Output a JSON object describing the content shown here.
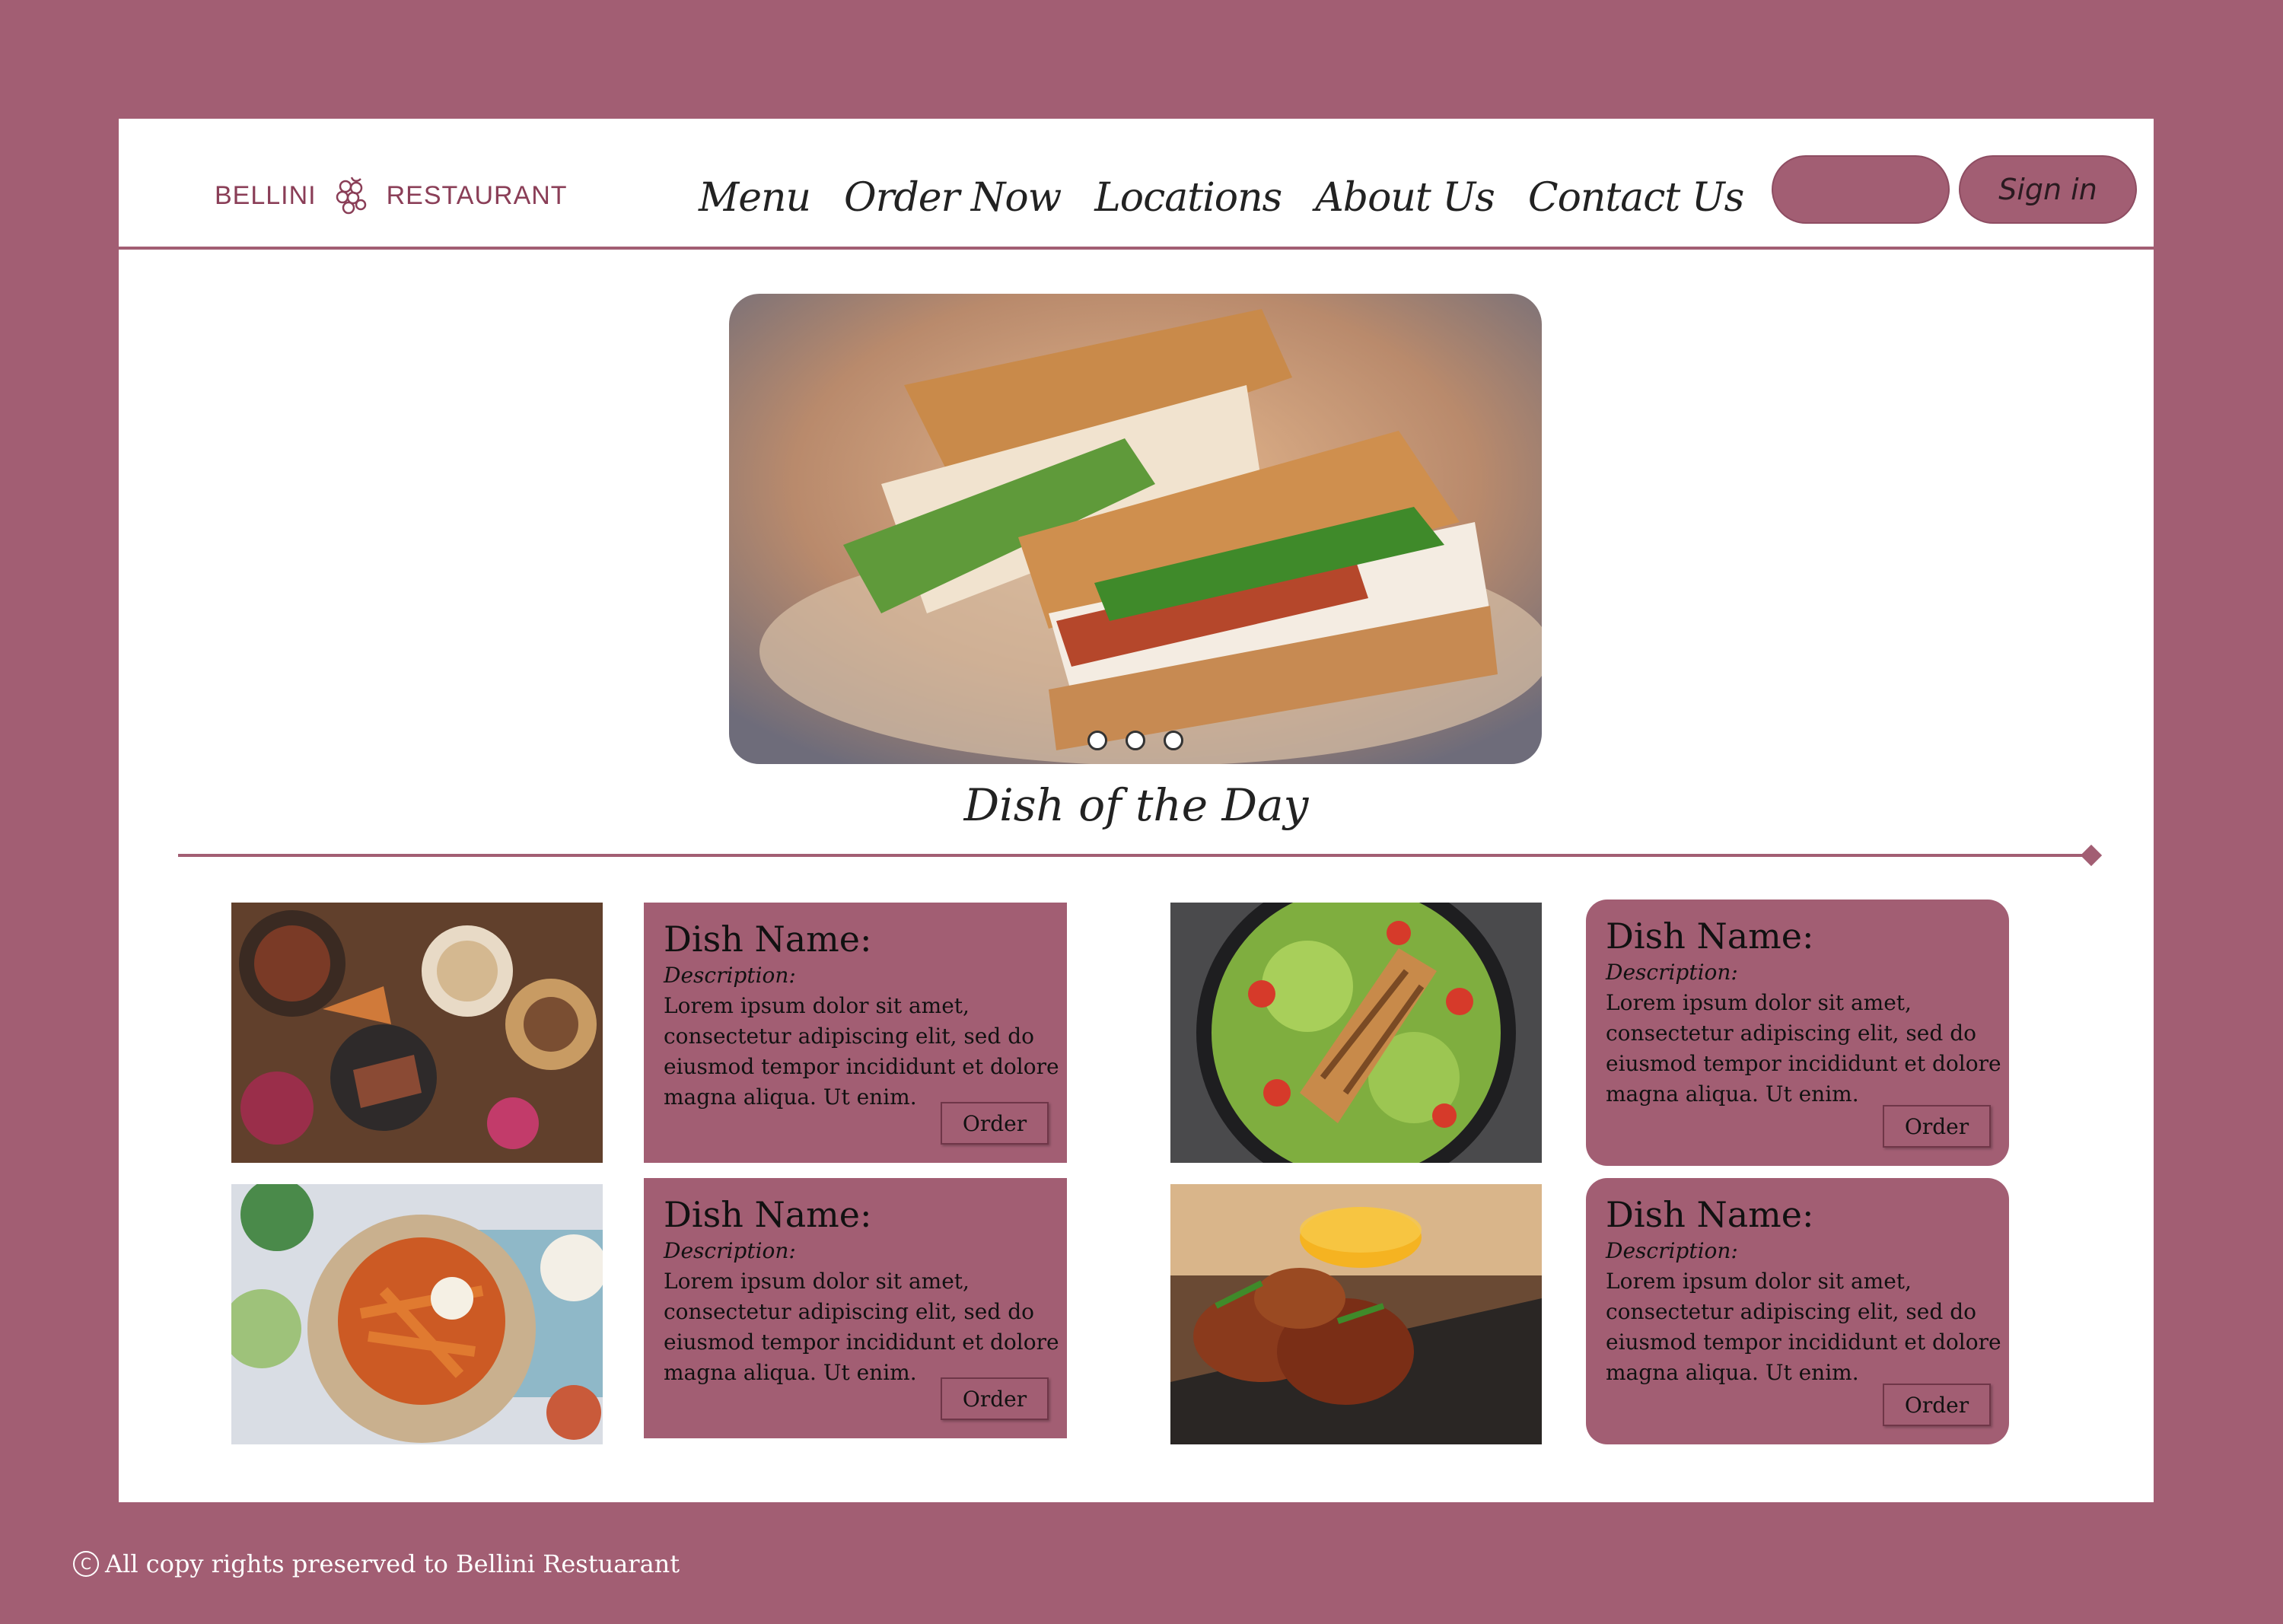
{
  "brand": {
    "name_left": "BELLINI",
    "name_right": "RESTAURANT",
    "logo_icon": "grape-cluster-icon",
    "color": "#8a3e57"
  },
  "nav": {
    "items": [
      {
        "label": "Menu"
      },
      {
        "label": "Order Now"
      },
      {
        "label": "Locations"
      },
      {
        "label": "About Us"
      },
      {
        "label": "Contact Us"
      }
    ]
  },
  "header_buttons": {
    "blank_label": "",
    "signin_label": "Sign in"
  },
  "hero": {
    "image": "sandwich-photo",
    "title": "Dish of the Day",
    "carousel_dots": 3
  },
  "dishes": [
    {
      "image": "steak-platter-photo",
      "name": "Dish Name:",
      "desc_label": "Description:",
      "text": "Lorem ipsum dolor sit amet, consectetur adipiscing elit, sed do eiusmod tempor incididunt et dolore magna aliqua. Ut enim.",
      "order_label": "Order"
    },
    {
      "image": "chicken-salad-photo",
      "name": "Dish Name:",
      "desc_label": "Description:",
      "text": "Lorem ipsum dolor sit amet, consectetur adipiscing elit, sed do eiusmod tempor incididunt et dolore magna aliqua. Ut enim.",
      "order_label": "Order"
    },
    {
      "image": "sweet-potato-fries-photo",
      "name": "Dish Name:",
      "desc_label": "Description:",
      "text": "Lorem ipsum dolor sit amet, consectetur adipiscing elit, sed do eiusmod tempor incididunt et dolore magna aliqua. Ut enim.",
      "order_label": "Order"
    },
    {
      "image": "chicken-wings-photo",
      "name": "Dish Name:",
      "desc_label": "Description:",
      "text": "Lorem ipsum dolor sit amet, consectetur adipiscing elit, sed do eiusmod tempor incididunt et dolore magna aliqua. Ut enim.",
      "order_label": "Order"
    }
  ],
  "footer": {
    "icon": "copyright-icon",
    "text": "All copy rights preserved to Bellini Restuarant"
  },
  "colors": {
    "accent": "#a25e73",
    "background": "#a25e73",
    "panel": "#ffffff"
  }
}
